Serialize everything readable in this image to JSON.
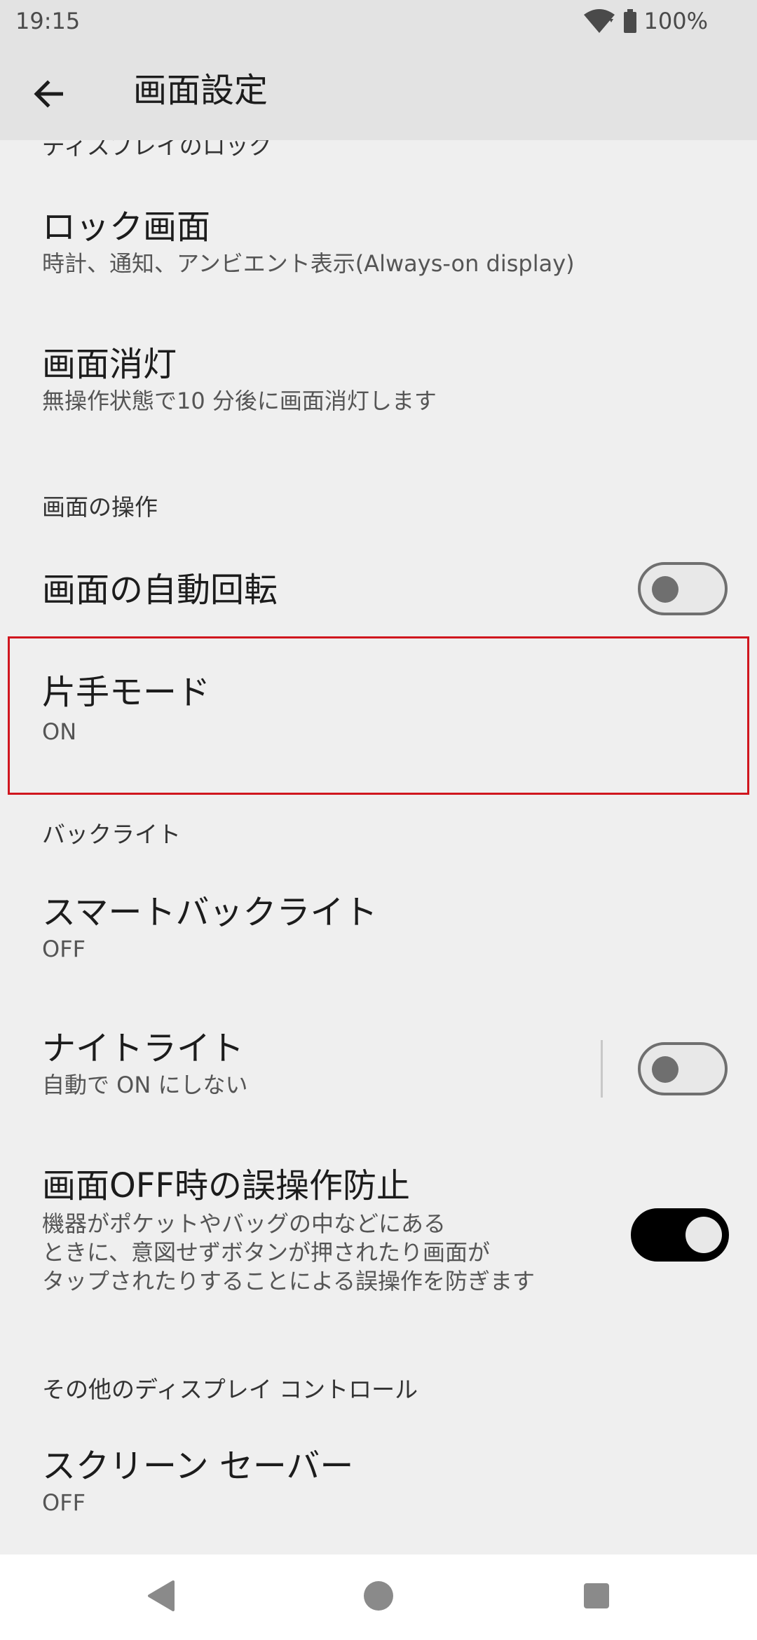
{
  "status_bar": {
    "time": "19:15",
    "battery": "100%",
    "icons": [
      "wifi-icon",
      "battery-icon"
    ]
  },
  "app_bar": {
    "title": "画面設定",
    "back_icon": "arrow-back-icon"
  },
  "sections": {
    "lock_partial_header": "ディスプレイのロック",
    "screen_operation_header": "画面の操作",
    "backlight_header": "バックライト",
    "other_controls_header": "その他のディスプレイ コントロール"
  },
  "items": {
    "lock_screen": {
      "title": "ロック画面",
      "summary": "時計、通知、アンビエント表示(Always-on display)"
    },
    "screen_timeout": {
      "title": "画面消灯",
      "summary": "無操作状態で10 分後に画面消灯します"
    },
    "auto_rotate": {
      "title": "画面の自動回転",
      "toggle_on": false
    },
    "one_handed_mode": {
      "title": "片手モード",
      "summary": "ON"
    },
    "smart_backlight": {
      "title": "スマートバックライト",
      "summary": "OFF"
    },
    "night_light": {
      "title": "ナイトライト",
      "summary": "自動で ON にしない",
      "toggle_on": false
    },
    "screen_off_protection": {
      "title": "画面OFF時の誤操作防止",
      "summary": "機器がポケットやバッグの中などにある\nときに、意図せずボタンが押されたり画面が\nタップされたりすることによる誤操作を防ぎます",
      "toggle_on": true
    },
    "screen_saver": {
      "title": "スクリーン セーバー",
      "summary": "OFF"
    }
  },
  "colors": {
    "background": "#efefef",
    "bar_background": "#e3e3e3",
    "highlight": "#d0161e",
    "toggle_on": "#000000",
    "toggle_off": "#6f6f6f"
  },
  "nav_bar": {
    "icons": [
      "back-triangle-icon",
      "home-circle-icon",
      "recents-square-icon"
    ]
  }
}
